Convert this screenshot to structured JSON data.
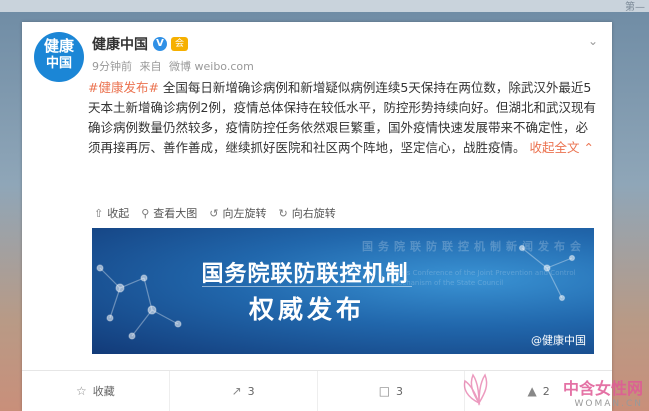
{
  "top_edge_text": "第—",
  "post": {
    "avatar_text_line1": "健康",
    "avatar_text_line2": "中国",
    "author": "健康中国",
    "verified_badge": "V",
    "member_badge": "会",
    "meta": {
      "time": "9分钟前",
      "source_label": "来自",
      "source": "微博 weibo.com"
    },
    "hashtag": "#健康发布#",
    "body": " 全国每日新增确诊病例和新增疑似病例连续5天保持在两位数，除武汉外最近5天本土新增确诊病例2例，疫情总体保持在较低水平，防控形势持续向好。但湖北和武汉现有确诊病例数量仍然较多，疫情防控任务依然艰巨繁重，国外疫情快速发展带来不确定性，必须再接再厉、善作善成，继续抓好医院和社区两个阵地，坚定信心，战胜疫情。",
    "collapse": " 收起全文 ⌃"
  },
  "toolbar": {
    "collapse": "收起",
    "view_large": "查看大图",
    "rotate_left": "向左旋转",
    "rotate_right": "向右旋转"
  },
  "media": {
    "title": "国务院联防联控机制",
    "subtitle": "权威发布",
    "bg_text": "国务院联防联控机制新闻发布会",
    "bg_text_en": "Press Conference of the Joint Prevention and Control Mechanism of the State Council",
    "watermark": "@健康中国"
  },
  "footer": {
    "favorite": "收藏",
    "share_count": "3",
    "comment_count": "3",
    "like_count": "2"
  },
  "site_watermark": {
    "main": "中含女性网",
    "sub": "WOMAN.CN"
  },
  "colors": {
    "accent": "#eb7350",
    "avatar_bg": "#1b86d6",
    "banner_bg": "#2167ac"
  },
  "icons": [
    "chevron-down-icon",
    "verified-icon",
    "member-icon",
    "collapse-icon",
    "zoom-icon",
    "rotate-left-icon",
    "rotate-right-icon",
    "star-icon",
    "share-icon",
    "comment-icon",
    "like-icon"
  ]
}
